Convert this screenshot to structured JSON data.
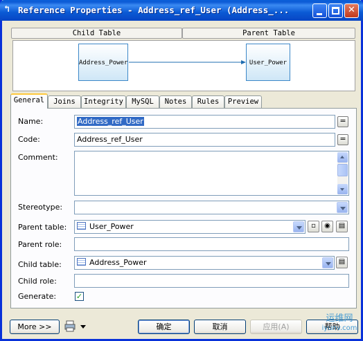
{
  "window": {
    "title": "Reference Properties - Address_ref_User (Address_...",
    "title_icon": "reference-icon"
  },
  "diagram": {
    "child_table_header": "Child Table",
    "parent_table_header": "Parent Table",
    "child_entity": "Address_Power",
    "parent_entity": "User_Power"
  },
  "tabs": [
    "General",
    "Joins",
    "Integrity",
    "MySQL",
    "Notes",
    "Rules",
    "Preview"
  ],
  "active_tab": "General",
  "form": {
    "name_label": "Name:",
    "name_value": "Address_ref_User",
    "code_label": "Code:",
    "code_value": "Address_ref_User",
    "eq_label": "=",
    "comment_label": "Comment:",
    "comment_value": "",
    "stereotype_label": "Stereotype:",
    "stereotype_value": "",
    "parent_table_label": "Parent table:",
    "parent_table_value": "User_Power",
    "parent_role_label": "Parent role:",
    "parent_role_value": "",
    "child_table_label": "Child table:",
    "child_table_value": "Address_Power",
    "child_role_label": "Child role:",
    "child_role_value": "",
    "generate_label": "Generate:",
    "generate_checked": true
  },
  "buttons": {
    "more": "More >>",
    "ok": "确定",
    "cancel": "取消",
    "apply": "应用(A)",
    "help": "帮助"
  },
  "watermark": {
    "line1": "运维网",
    "line2": "iyunv.com"
  }
}
